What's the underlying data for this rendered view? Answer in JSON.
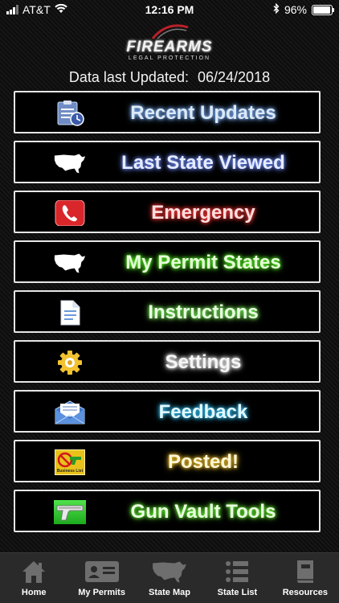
{
  "status": {
    "carrier": "AT&T",
    "time": "12:16 PM",
    "battery": "96%"
  },
  "logo": {
    "brand": "FIREARMS",
    "sub": "LEGAL PROTECTION"
  },
  "updated": {
    "label": "Data last Updated:",
    "date": "06/24/2018"
  },
  "menu": [
    {
      "label": "Recent Updates",
      "color": "#dce9f5",
      "glow": "#7fb3ff"
    },
    {
      "label": "Last State Viewed",
      "color": "#e6ecff",
      "glow": "#6f8cff"
    },
    {
      "label": "Emergency",
      "color": "#ffe0e0",
      "glow": "#ff3a3a"
    },
    {
      "label": "My Permit States",
      "color": "#e6ffd8",
      "glow": "#5cff2a"
    },
    {
      "label": "Instructions",
      "color": "#e9ffe2",
      "glow": "#80ff60"
    },
    {
      "label": "Settings",
      "color": "#f5f5f5",
      "glow": "#ffffff"
    },
    {
      "label": "Feedback",
      "color": "#e2faff",
      "glow": "#37c6ff"
    },
    {
      "label": "Posted!",
      "color": "#fff7d8",
      "glow": "#ffcc33"
    },
    {
      "label": "Gun Vault Tools",
      "color": "#e9ffe0",
      "glow": "#6dff3a"
    }
  ],
  "posted_icon_text": "Business List",
  "tabs": [
    {
      "label": "Home"
    },
    {
      "label": "My Permits"
    },
    {
      "label": "State Map"
    },
    {
      "label": "State List"
    },
    {
      "label": "Resources"
    }
  ]
}
